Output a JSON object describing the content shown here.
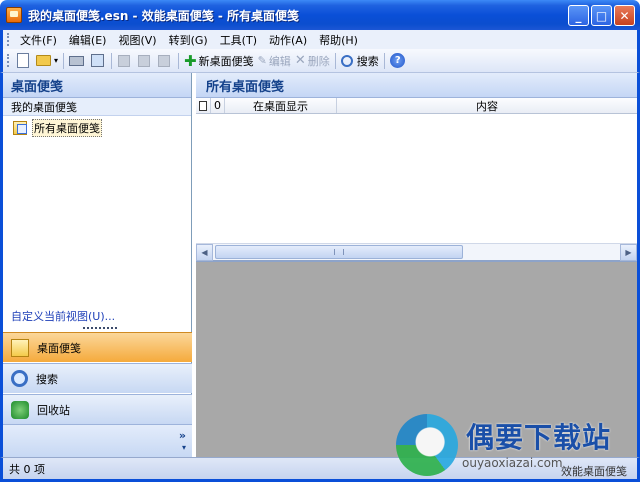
{
  "window": {
    "title": "我的桌面便笺.esn - 效能桌面便笺 - 所有桌面便笺",
    "minimize": "_",
    "maximize": "□",
    "close": "✕"
  },
  "menu": [
    "文件(F)",
    "编辑(E)",
    "视图(V)",
    "转到(G)",
    "工具(T)",
    "动作(A)",
    "帮助(H)"
  ],
  "toolbar": {
    "new_note": "新桌面便笺",
    "edit": "编辑",
    "delete": "删除",
    "search": "搜索",
    "help": "?"
  },
  "left_pane": {
    "header": "桌面便笺",
    "group": "我的桌面便笺",
    "tree_item": "所有桌面便笺",
    "customize_view": "自定义当前视图(U)...",
    "nav": {
      "notes": "桌面便笺",
      "search": "搜索",
      "recycle": "回收站"
    },
    "chevron": "»",
    "more_arrow": "▾"
  },
  "right_pane": {
    "header": "所有桌面便笺",
    "columns": {
      "attach": "0",
      "show_on_desktop": "在桌面显示",
      "content": "内容"
    }
  },
  "status": {
    "left": "共 0 项",
    "right": "效能桌面便笺"
  },
  "watermark": {
    "title": "偶要下载站",
    "subtitle": "ouyaoxiazai.com"
  },
  "colors": {
    "title_bar": "#0a4fd8",
    "pane_header_text": "#15428b",
    "active_nav": "#f5aa3c",
    "preview": "#a8a8a8"
  }
}
